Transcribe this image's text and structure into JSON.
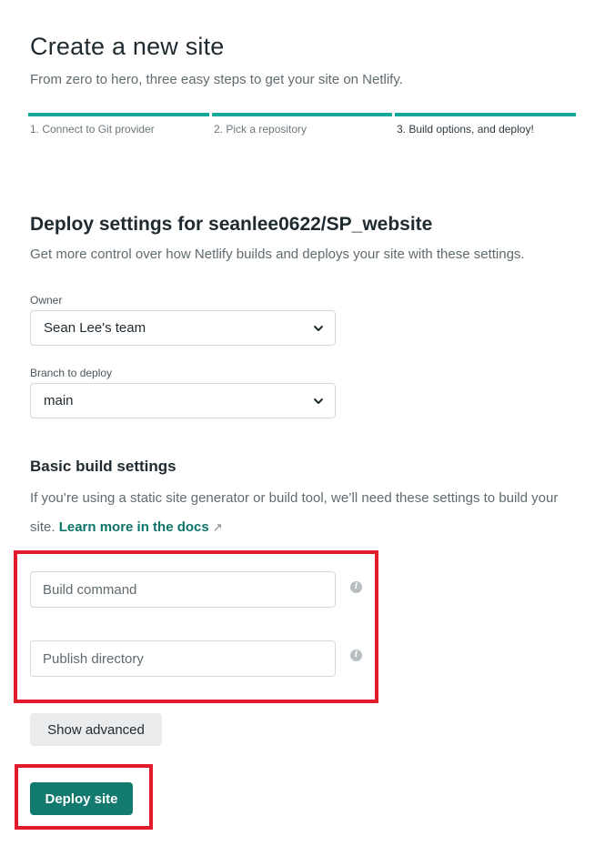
{
  "header": {
    "title": "Create a new site",
    "subtitle": "From zero to hero, three easy steps to get your site on Netlify."
  },
  "steps": [
    {
      "label": "1. Connect to Git provider",
      "active": false
    },
    {
      "label": "2. Pick a repository",
      "active": false
    },
    {
      "label": "3. Build options, and deploy!",
      "active": true
    }
  ],
  "deploy_settings": {
    "title": "Deploy settings for seanlee0622/SP_website",
    "description": "Get more control over how Netlify builds and deploys your site with these settings.",
    "owner": {
      "label": "Owner",
      "value": "Sean Lee's team"
    },
    "branch": {
      "label": "Branch to deploy",
      "value": "main"
    }
  },
  "basic_build": {
    "title": "Basic build settings",
    "description": "If you’re using a static site generator or build tool, we’ll need these settings to build your site.",
    "docs_link": "Learn more in the docs",
    "docs_arrow": "↗",
    "build_command": {
      "placeholder": "Build command",
      "value": ""
    },
    "publish_directory": {
      "placeholder": "Publish directory",
      "value": ""
    },
    "info_glyph": "i"
  },
  "buttons": {
    "show_advanced": "Show advanced",
    "deploy": "Deploy site"
  },
  "colors": {
    "accent": "#14a89a",
    "deploy_button": "#137a6f",
    "link": "#0e7469",
    "highlight_box": "#e11b2b"
  }
}
